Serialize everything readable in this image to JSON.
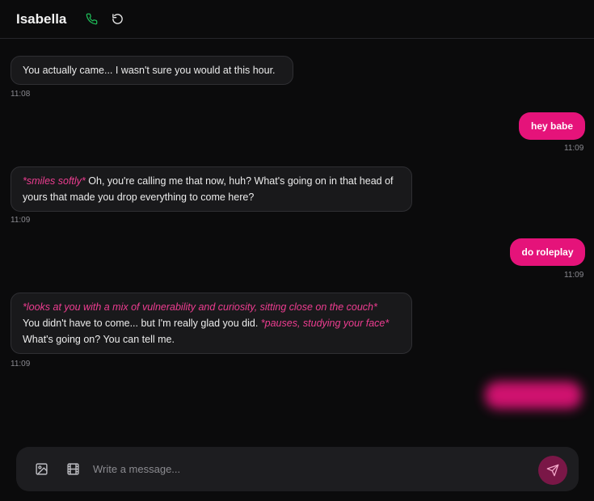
{
  "header": {
    "title": "Isabella",
    "icons": [
      "phone-icon",
      "reset-icon"
    ]
  },
  "messages": [
    {
      "from": "bot",
      "text": "You actually came... I wasn't sure you would at this hour.",
      "time": "11:08"
    },
    {
      "from": "user",
      "text": "hey babe",
      "time": "11:09"
    },
    {
      "from": "bot",
      "action": "*smiles softly*",
      "text": " Oh, you're calling me that now, huh? What's going on in that head of yours that made you drop everything to come here?",
      "time": "11:09"
    },
    {
      "from": "user",
      "text": "do roleplay",
      "time": "11:09"
    },
    {
      "from": "bot",
      "action": "*looks at you with a mix of vulnerability and curiosity, sitting close on the couch*",
      "text": "You didn't have to come... but I'm really glad you did.",
      "action2": "*pauses, studying your face*",
      "text2": "What's going on? You can tell me.",
      "time": "11:09"
    }
  ],
  "composer": {
    "placeholder": "Write a message...",
    "icons": [
      "image-icon",
      "video-icon",
      "send-icon"
    ]
  },
  "colors": {
    "accent": "#e5137a",
    "background": "#0b0b0c",
    "bubble": "#19191b",
    "call": "#1fbf5a"
  }
}
